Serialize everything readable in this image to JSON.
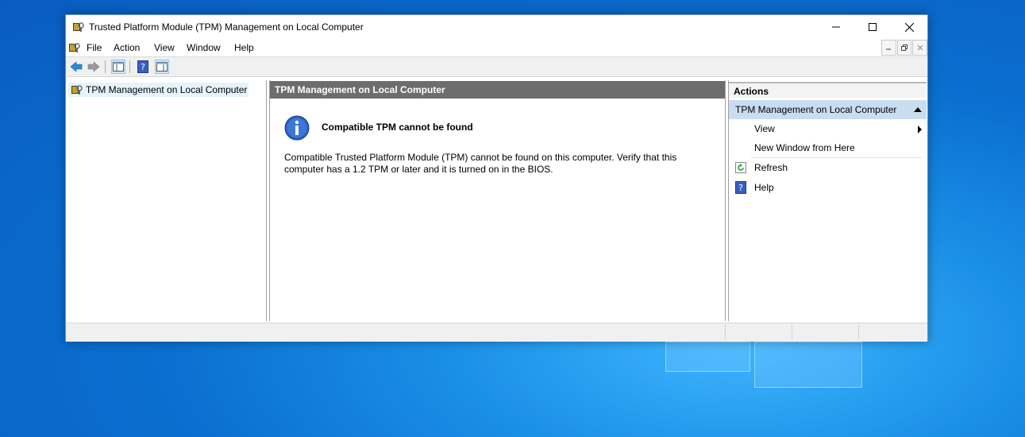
{
  "window": {
    "title": "Trusted Platform Module (TPM) Management on Local Computer",
    "icon": "tpm-chip-icon",
    "controls": {
      "minimize": "minimize-icon",
      "maximize": "maximize-icon",
      "close": "close-icon"
    }
  },
  "menu": {
    "items": [
      "File",
      "Action",
      "View",
      "Window",
      "Help"
    ]
  },
  "toolbar": {
    "buttons": [
      "back-arrow-icon",
      "forward-arrow-icon",
      "show-hide-console-tree-icon",
      "help-icon",
      "show-hide-action-pane-icon"
    ]
  },
  "tree": {
    "items": [
      {
        "label": "TPM Management on Local Computer",
        "icon": "tpm-chip-icon"
      }
    ]
  },
  "content": {
    "header": "TPM Management on Local Computer",
    "message_title": "Compatible TPM cannot be found",
    "message_body": "Compatible Trusted Platform Module (TPM) cannot be found on this computer. Verify that this computer has a 1.2 TPM or later and it is turned on in the BIOS."
  },
  "actions": {
    "header": "Actions",
    "group": "TPM Management on Local Computer",
    "items": [
      "View",
      "New Window from Here",
      "Refresh",
      "Help"
    ]
  },
  "colors": {
    "content_header_bg": "#6d6d6d",
    "actions_group_bg": "#c9ddf1",
    "selection_bg": "#e5f3fb",
    "desktop_blue": "#0a6fd0"
  }
}
